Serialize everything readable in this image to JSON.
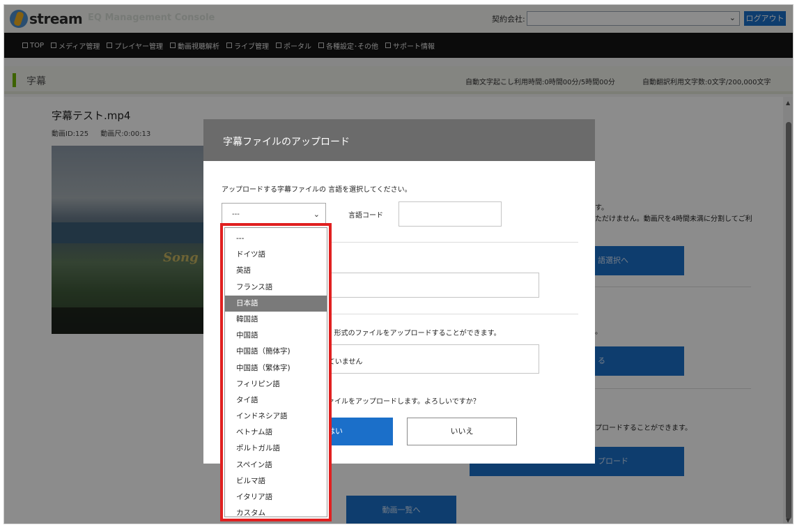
{
  "header": {
    "logo_text": "stream",
    "app_title": "EQ Management Console",
    "company_label": "契約会社:",
    "company_value": "",
    "logout_label": "ログアウト"
  },
  "nav": {
    "items": [
      "TOP",
      "メディア管理",
      "プレイヤー管理",
      "動画視聴解析",
      "ライブ管理",
      "ポータル",
      "各種設定･その他",
      "サポート情報"
    ]
  },
  "page": {
    "title": "字幕",
    "usage_transcribe": "自動文字起こし利用時間:0時間00分/5時間00分",
    "usage_translate": "自動翻訳利用文字数:0文字/200,000文字"
  },
  "video": {
    "title": "字幕テスト.mp4",
    "id_label": "動画ID:125",
    "length_label": "動画尺:0:00:13",
    "overlay_text": "Song"
  },
  "background": {
    "text_line1": "す。",
    "text_line2": "ただけません。動画尺を4時間未満に分割してご利",
    "button1_label": "語選択へ",
    "dot_text": "。",
    "button2_label": "る",
    "text_line3": "プロードすることができます。",
    "button3_label": "プロード",
    "list_button_label": "動画一覧へ"
  },
  "modal": {
    "title": "字幕ファイルのアップロード",
    "instruction": "アップロードする字幕ファイルの 言語を選択してください。",
    "selected_language": "---",
    "code_label": "言語コード",
    "code_value": "",
    "format_note": "ml) 形式のファイルをアップロードすることができます。",
    "file_status": "れていません",
    "confirm_text": "ファイルをアップロードします。よろしいですか？",
    "yes_label": "はい",
    "no_label": "いいえ"
  },
  "dropdown": {
    "options": [
      "---",
      "ドイツ語",
      "英語",
      "フランス語",
      "日本語",
      "韓国語",
      "中国語",
      "中国語（簡体字)",
      "中国語（繁体字)",
      "フィリピン語",
      "タイ語",
      "インドネシア語",
      "ベトナム語",
      "ポルトガル語",
      "スペイン語",
      "ビルマ語",
      "イタリア語",
      "カスタム"
    ],
    "highlighted": "日本語",
    "highlight_color": "#e02020"
  },
  "colors": {
    "primary_button": "#1b6fc9",
    "nav_bg": "#151515",
    "accent": "#6fb400",
    "modal_header": "#6b6b6b"
  }
}
